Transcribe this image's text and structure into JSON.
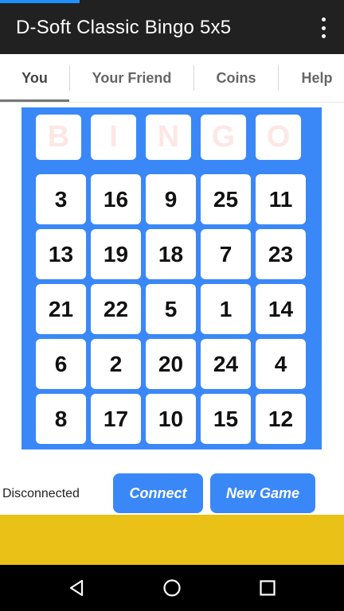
{
  "app": {
    "title": "D-Soft Classic Bingo 5x5"
  },
  "tabs": [
    {
      "label": "You",
      "active": true
    },
    {
      "label": "Your Friend",
      "active": false
    },
    {
      "label": "Coins",
      "active": false
    },
    {
      "label": "Help",
      "active": false
    }
  ],
  "board": {
    "header": [
      "B",
      "I",
      "N",
      "G",
      "O"
    ],
    "rows": [
      [
        "3",
        "16",
        "9",
        "25",
        "11"
      ],
      [
        "13",
        "19",
        "18",
        "7",
        "23"
      ],
      [
        "21",
        "22",
        "5",
        "1",
        "14"
      ],
      [
        "6",
        "2",
        "20",
        "24",
        "4"
      ],
      [
        "8",
        "17",
        "10",
        "15",
        "12"
      ]
    ]
  },
  "status": {
    "text": "Disconnected"
  },
  "buttons": {
    "connect": "Connect",
    "new_game": "New Game"
  },
  "colors": {
    "accent": "#3a88f8",
    "banner": "#eac116",
    "appbar": "#212121"
  },
  "icons": {
    "menu": "overflow-menu-icon",
    "back": "back-icon",
    "home": "home-icon",
    "recents": "recents-icon"
  }
}
